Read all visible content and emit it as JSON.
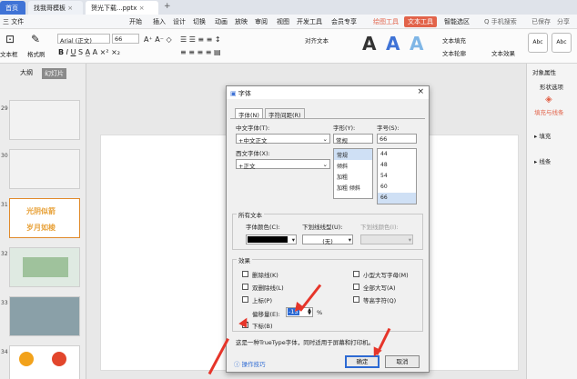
{
  "tabs": {
    "home": "首页",
    "t1": "找我哥模板",
    "t2": "贺光下载...pptx"
  },
  "menu": [
    "三 文件",
    "开始",
    "插入",
    "设计",
    "切换",
    "动画",
    "放映",
    "审阅",
    "视图",
    "开发工具",
    "会员专享",
    "绘图工具",
    "文本工具",
    "智能选区",
    "Q 手机搜索",
    "已保存",
    "分享"
  ],
  "ribbon": {
    "font": "Arial (正文)",
    "size": "66",
    "text_fill": "文本填充",
    "text_outline": "文本轮廓",
    "text_effect": "文本效果",
    "style1": "Abc",
    "style2": "Abc",
    "format_painter": "格式刷",
    "paste": "粘贴",
    "textbox": "文本框",
    "align_text": "对齐文本"
  },
  "left": {
    "tab1": "大纲",
    "tab2": "幻灯片",
    "slides": [
      "29",
      "30",
      "31",
      "32",
      "33",
      "34"
    ],
    "slide31_line1": "光阴似箭",
    "slide31_line2": "岁月如梭"
  },
  "right": {
    "title": "对象属性",
    "shape_opt": "形状选项",
    "fill_outline": "填充与线条",
    "fill": "填充",
    "line": "线条"
  },
  "dialog": {
    "title": "字体",
    "tab_font": "字体(N)",
    "tab_spacing": "字符间距(R)",
    "cn_font_label": "中文字体(T):",
    "cn_font_value": "+中文正文",
    "west_font_label": "西文字体(X):",
    "west_font_value": "+正文",
    "style_label": "字形(Y):",
    "style_value": "常规",
    "style_options": [
      "常规",
      "倾斜",
      "加粗",
      "加粗 倾斜"
    ],
    "size_label": "字号(S):",
    "size_value": "66",
    "size_options": [
      "44",
      "48",
      "54",
      "60",
      "66"
    ],
    "all_text": "所有文本",
    "font_color_label": "字体颜色(C):",
    "underline_type_label": "下划线线型(U):",
    "underline_type_value": "(无)",
    "underline_color_label": "下划线颜色(I):",
    "effects": "效果",
    "strike": "删除线(K)",
    "dbl_strike": "双删除线(L)",
    "superscript": "上标(P)",
    "offset_label": "偏移量(E):",
    "offset_value": "-15",
    "offset_unit": "%",
    "subscript": "下标(B)",
    "small_caps": "小型大写字母(M)",
    "all_caps": "全部大写(A)",
    "equal_height": "等高字符(Q)",
    "note": "这是一种TrueType字体，同时适用于屏幕和打印机。",
    "tips": "操作技巧",
    "ok": "确定",
    "cancel": "取消"
  },
  "colors": {
    "accent": "#e2634a",
    "brand_blue": "#3f73d6",
    "arrow": "#e6352a"
  }
}
